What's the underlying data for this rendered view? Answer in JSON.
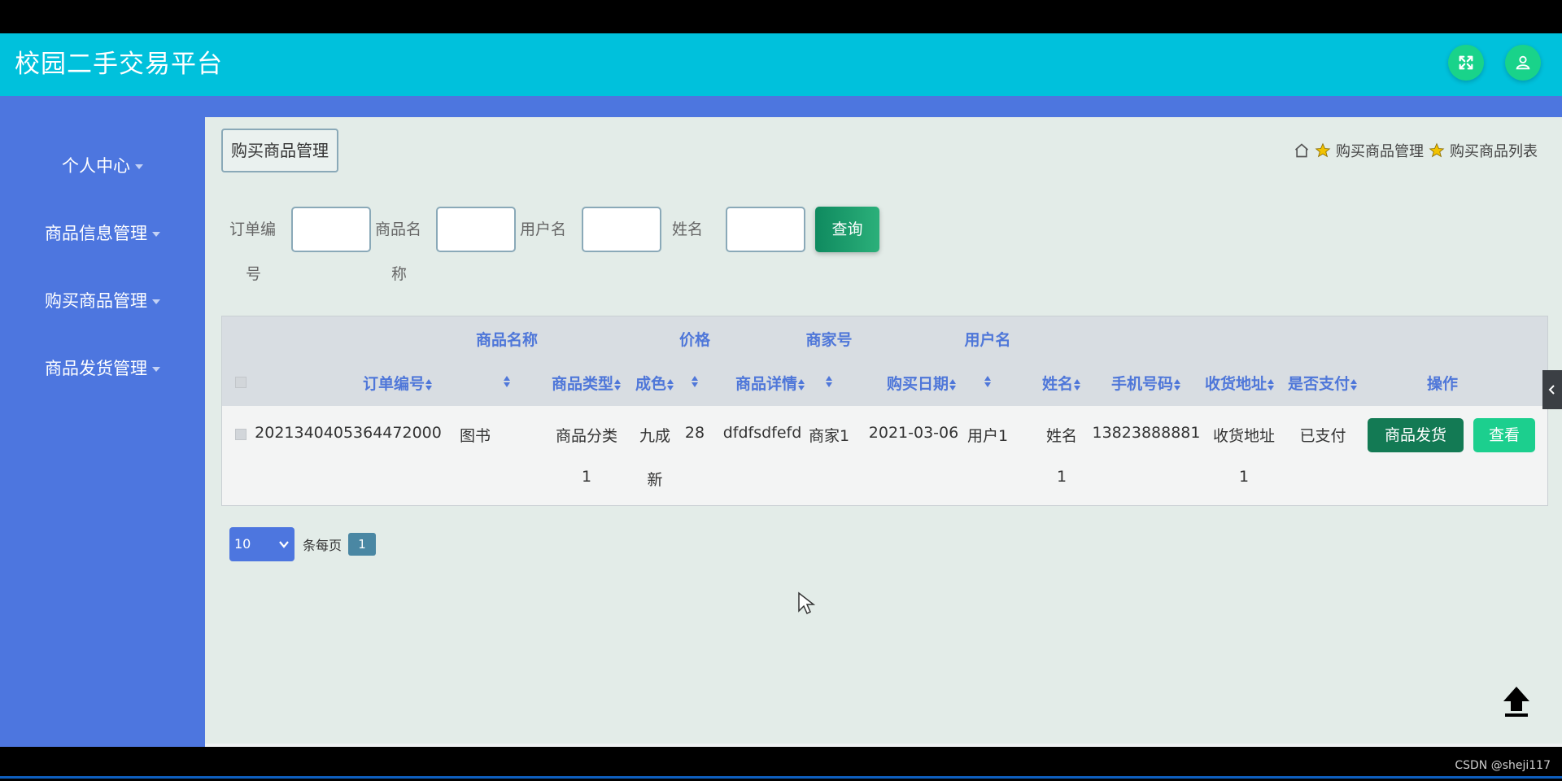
{
  "app": {
    "title": "校园二手交易平台",
    "accent": "#00c1dc",
    "sidebar_color": "#4d76df"
  },
  "header_icons": [
    "fullscreen-icon",
    "user-icon"
  ],
  "sidebar": {
    "items": [
      {
        "label": "个人中心"
      },
      {
        "label": "商品信息管理"
      },
      {
        "label": "购买商品管理"
      },
      {
        "label": "商品发货管理"
      }
    ]
  },
  "page": {
    "title": "购买商品管理",
    "breadcrumb": [
      "购买商品管理",
      "购买商品列表"
    ]
  },
  "search": {
    "fields": [
      {
        "label_line1": "订单编",
        "label_line2": "号",
        "value": ""
      },
      {
        "label_line1": "商品名",
        "label_line2": "称",
        "value": ""
      },
      {
        "label_line1": "用户名",
        "label_line2": "",
        "value": ""
      },
      {
        "label_line1": "姓名",
        "label_line2": "",
        "value": ""
      }
    ],
    "query_label": "查询"
  },
  "table": {
    "headers": {
      "order_no": "订单编号",
      "goods_name": "商品名称",
      "goods_type": "商品类型",
      "condition": "成色",
      "price": "价格",
      "detail": "商品详情",
      "merchant": "商家号",
      "date": "购买日期",
      "username": "用户名",
      "name": "姓名",
      "phone": "手机号码",
      "address": "收货地址",
      "paid": "是否支付",
      "ops": "操作"
    },
    "rows": [
      {
        "order_no": "2021340405364472000",
        "goods_name": "图书",
        "goods_type_l1": "商品分类",
        "goods_type_l2": "1",
        "condition_l1": "九成",
        "condition_l2": "新",
        "price": "28",
        "detail": "dfdfsdfefd",
        "merchant": "商家1",
        "date": "2021-03-06",
        "username": "用户1",
        "name_l1": "姓名",
        "name_l2": "1",
        "phone": "13823888881",
        "address_l1": "收货地址",
        "address_l2": "1",
        "paid": "已支付",
        "ship_label": "商品发货",
        "view_label": "查看"
      }
    ]
  },
  "pager": {
    "page_size": "10",
    "per_page_label": "条每页",
    "current_page": "1"
  },
  "watermark": "CSDN @sheji117"
}
